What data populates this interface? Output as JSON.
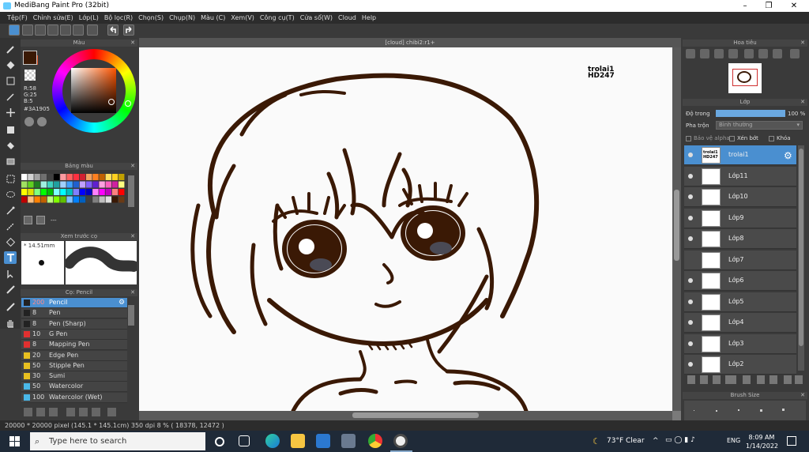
{
  "window": {
    "title": "MediBang Paint Pro (32bit)"
  },
  "menu": [
    "Tệp(F)",
    "Chỉnh sửa(E)",
    "Lớp(L)",
    "Bộ lọc(R)",
    "Chọn(S)",
    "Chụp(N)",
    "Màu (C)",
    "Xem(V)",
    "Công cụ(T)",
    "Cửa sổ(W)",
    "Cloud",
    "Help"
  ],
  "color_panel": {
    "title": "Màu",
    "r": "R:58",
    "g": "G:25",
    "b": "B:5",
    "hex": "#3A1905",
    "main_color": "#3a1905",
    "sub_color": "#e04a1a"
  },
  "palette_panel": {
    "title": "Bảng màu",
    "more": "---"
  },
  "brush_preview": {
    "title": "Xem trước cọ",
    "size": "14.51mm"
  },
  "brush_panel": {
    "title": "Cọ: Pencil",
    "items": [
      {
        "size": "200",
        "name": "Pencil",
        "color": "#222222"
      },
      {
        "size": "8",
        "name": "Pen",
        "color": "#222222"
      },
      {
        "size": "8",
        "name": "Pen (Sharp)",
        "color": "#222222"
      },
      {
        "size": "10",
        "name": "G Pen",
        "color": "#e03030"
      },
      {
        "size": "8",
        "name": "Mapping Pen",
        "color": "#e03030"
      },
      {
        "size": "20",
        "name": "Edge Pen",
        "color": "#e8c020"
      },
      {
        "size": "50",
        "name": "Stipple Pen",
        "color": "#e8c020"
      },
      {
        "size": "30",
        "name": "Sumi",
        "color": "#e8c020"
      },
      {
        "size": "50",
        "name": "Watercolor",
        "color": "#4ab8e8"
      },
      {
        "size": "100",
        "name": "Watercolor (Wet)",
        "color": "#4ab8e8"
      }
    ]
  },
  "canvas": {
    "tab": "[cloud] chibi2:r1+",
    "watermark_line1": "trolai1",
    "watermark_line2": "HD247"
  },
  "navigator": {
    "title": "Hoa tiêu"
  },
  "layer_panel": {
    "title": "Lớp",
    "opacity_label": "Độ trong",
    "opacity_value": "100 %",
    "blend_label": "Pha trộn",
    "blend_value": "Bình thường",
    "alpha_label": "Bảo vệ alpha",
    "clip_label": "Xén bớt",
    "lock_label": "Khóa",
    "layers": [
      {
        "name": "trolai1"
      },
      {
        "name": "Lớp11"
      },
      {
        "name": "Lớp10"
      },
      {
        "name": "Lớp9"
      },
      {
        "name": "Lớp8"
      },
      {
        "name": "Lớp7"
      },
      {
        "name": "Lớp6"
      },
      {
        "name": "Lớp5"
      },
      {
        "name": "Lớp4"
      },
      {
        "name": "Lớp3"
      },
      {
        "name": "Lớp2"
      }
    ]
  },
  "brush_size_panel": {
    "title": "Brush Size"
  },
  "status": {
    "text": "20000 * 20000 pixel  (145.1 * 145.1cm)  350 dpi  8 %  ( 18378, 12472 )"
  },
  "taskbar": {
    "search_placeholder": "Type here to search",
    "weather": "73°F  Clear",
    "lang": "ENG",
    "time": "8:09 AM",
    "date": "1/14/2022"
  },
  "ink_color": "#3a1905"
}
